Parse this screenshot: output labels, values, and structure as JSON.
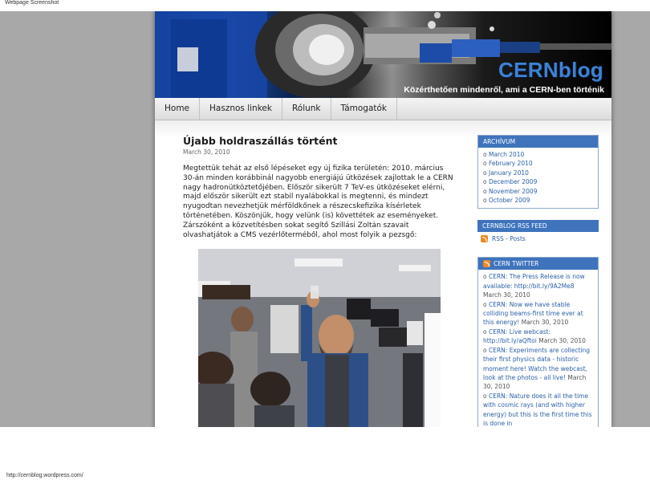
{
  "caption": "Webpage Screenshot",
  "footer_url": "http://cernblog.wordpress.com/",
  "header": {
    "title": "CERNblog",
    "tagline": "Közérthetően mindenről, ami a CERN-ben történik"
  },
  "nav": [
    "Home",
    "Hasznos linkek",
    "Rólunk",
    "Támogatók"
  ],
  "post": {
    "title": "Újabb holdraszállás történt",
    "date": "March 30, 2010",
    "body": "Megtettük tehát az első lépéseket egy új fizika területén: 2010. március 30-án minden korábbinál nagyobb energiájú ütközések zajlottak le a CERN nagy hadronütköztetőjében. Először sikerült 7 TeV-es ütközéseket elérni, majd először sikerült ezt stabil nyalábokkal is megtenni, és mindezt nyugodtan nevezhetjük mérföldkőnek a részecskefizika kísérletek történetében. Köszönjük, hogy velünk (is) követtétek az eseményeket. Zárszóként a közvetítésben sokat segítő Szillási Zoltán szavait olvashatjátok a CMS vezérlőterméből, ahol most folyik a pezsgő:"
  },
  "sidebar": {
    "archive": {
      "title": "ARCHÍVUM",
      "items": [
        "March 2010",
        "February 2010",
        "January 2010",
        "December 2009",
        "November 2009",
        "October 2009"
      ]
    },
    "rss": {
      "title": "CERNBLOG RSS FEED",
      "link": "RSS - Posts"
    },
    "twitter": {
      "title": "CERN TWITTER",
      "tweets": [
        {
          "text": "CERN: The Press Release is now available: http://bit.ly/9A2Me8",
          "date": "March 30, 2010"
        },
        {
          "text": "CERN: Now we have stable colliding beams-first time ever at this energy!",
          "date": "March 30, 2010"
        },
        {
          "text": "CERN: Live webcast: http://bit.ly/aQftoi",
          "date": "March 30, 2010"
        },
        {
          "text": "CERN: Experiments are collecting their first physics data - historic moment here! Watch the webcast, look at the photos - all live!",
          "date": "March 30, 2010"
        },
        {
          "text": "CERN: Nature does it all the time with cosmic rays (and with higher energy) but this is the first time this is done in",
          "date": ""
        }
      ]
    }
  }
}
